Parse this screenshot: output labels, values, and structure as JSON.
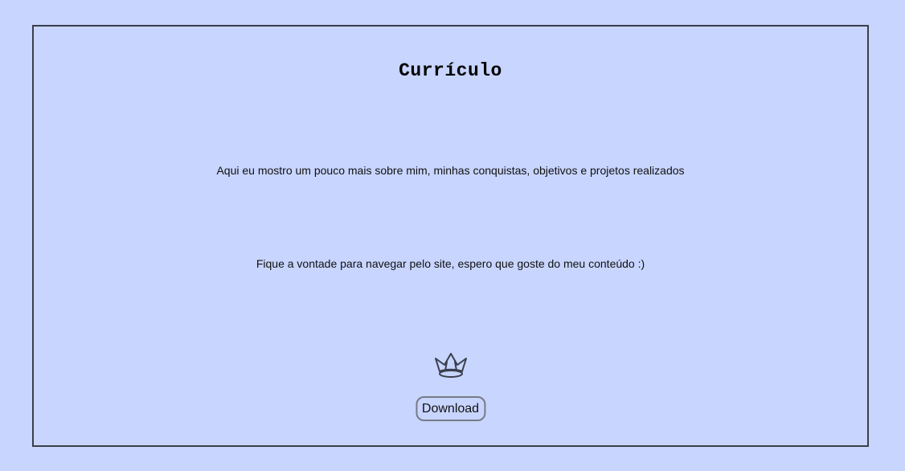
{
  "page": {
    "title": "Currículo",
    "intro": "Aqui eu mostro um pouco mais sobre mim, minhas conquistas, objetivos e projetos realizados",
    "welcome": "Fique a vontade para navegar pelo site, espero que goste do meu conteúdo :)",
    "icon": "crown-icon",
    "download_label": "Download"
  },
  "colors": {
    "background": "#c8d5ff",
    "border": "#3a3f4b",
    "text": "#111111"
  }
}
